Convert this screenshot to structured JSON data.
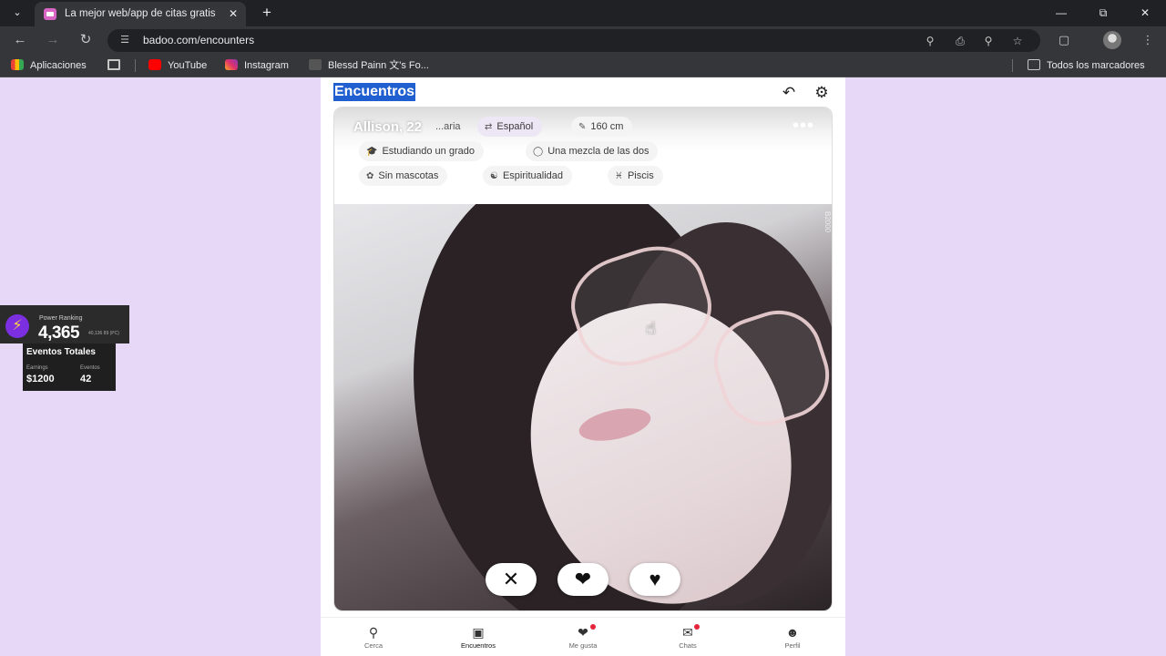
{
  "browser": {
    "tab_title": "La mejor web/app de citas gratis",
    "url": "badoo.com/encounters",
    "bookmarks": {
      "apps": "Aplicaciones",
      "youtube": "YouTube",
      "instagram": "Instagram",
      "blessd": "Blessd Painn 文's Fo...",
      "all": "Todos los marcadores"
    }
  },
  "page": {
    "title": "Encuentros"
  },
  "profile": {
    "name": "Allison, 22",
    "chips": [
      {
        "icon": "translate-icon",
        "label": "Español"
      },
      {
        "icon": "ruler-icon",
        "label": "160 cm"
      },
      {
        "icon": "education-icon",
        "label": "Estudiando un grado"
      },
      {
        "icon": "chat-bubble-icon",
        "label": "Una mezcla de las dos"
      },
      {
        "icon": "paw-icon",
        "label": "Sin mascotas"
      },
      {
        "icon": "spirituality-icon",
        "label": "Espiritualidad"
      },
      {
        "icon": "zodiac-icon",
        "label": "Piscis"
      }
    ],
    "partial_chip": "...aria",
    "photo_watermark": "B2000"
  },
  "bottom_nav": [
    {
      "label": "Cerca",
      "icon": "location-pin-icon"
    },
    {
      "label": "Encuentros",
      "icon": "cards-icon",
      "active": true
    },
    {
      "label": "Me gusta",
      "icon": "hearts-icon",
      "badge": true
    },
    {
      "label": "Chats",
      "icon": "chat-icon",
      "badge": true
    },
    {
      "label": "Perfil",
      "icon": "person-icon"
    }
  ],
  "overlay": {
    "power_label": "Power Ranking",
    "power_value": "4,365",
    "power_sub": "40,136 89 (PC)",
    "events_title": "Eventos Totales",
    "earnings_label": "Earnings",
    "earnings_value": "$1200",
    "eventos_label": "Eventos",
    "eventos_value": "42"
  },
  "colors": {
    "page_background": "#e8d8f7",
    "selection_highlight": "#1f5fd0",
    "badge_red": "#e5253c",
    "power_purple": "#7b2fe0"
  }
}
